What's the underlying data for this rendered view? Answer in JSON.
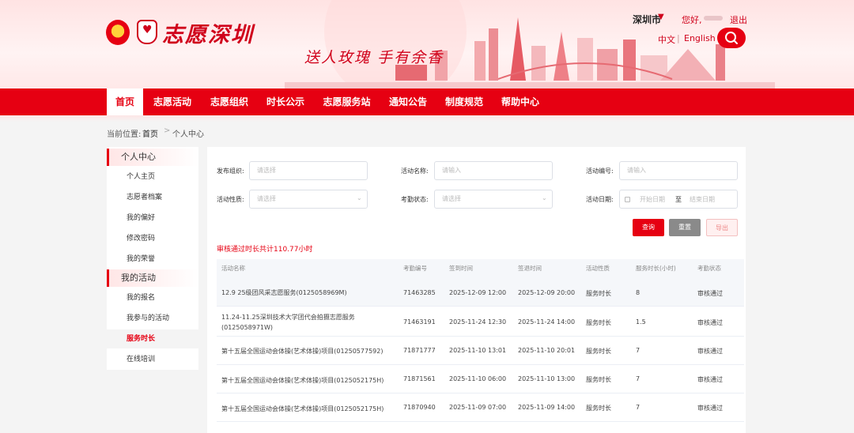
{
  "header": {
    "logo_text": "志愿深圳",
    "slogan": "送人玫瑰 手有余香",
    "city": "深圳市",
    "greeting": "您好,",
    "logout": "退出",
    "lang_zh": "中文",
    "lang_sep": "|",
    "lang_en": "English"
  },
  "nav": {
    "items": [
      "首页",
      "志愿活动",
      "志愿组织",
      "时长公示",
      "志愿服务站",
      "通知公告",
      "制度规范",
      "帮助中心"
    ]
  },
  "breadcrumb": {
    "prefix": "当前位置:",
    "home": "首页",
    "separator": ">",
    "current": "个人中心"
  },
  "sidebar": {
    "group1": "个人中心",
    "group1_items": [
      "个人主页",
      "志愿者档案",
      "我的偏好",
      "修改密码",
      "我的荣誉"
    ],
    "group2": "我的活动",
    "group2_items": [
      "我的报名",
      "我参与的活动",
      "服务时长",
      "在线培训"
    ]
  },
  "filters": {
    "org_label": "发布组织:",
    "org_placeholder": "请选择",
    "name_label": "活动名称:",
    "name_placeholder": "请输入",
    "code_label": "活动编号:",
    "code_placeholder": "请输入",
    "nature_label": "活动性质:",
    "nature_placeholder": "请选择",
    "attendance_label": "考勤状态:",
    "attendance_placeholder": "请选择",
    "date_label": "活动日期:",
    "date_start": "开始日期",
    "date_sep": "至",
    "date_end": "结束日期"
  },
  "buttons": {
    "query": "查询",
    "reset": "重置",
    "export": "导出"
  },
  "summary": "审核通过时长共计110.77小时",
  "table": {
    "columns": [
      "活动名称",
      "考勤编号",
      "签到时间",
      "签退时间",
      "活动性质",
      "服务时长(小时)",
      "考勤状态"
    ],
    "rows": [
      {
        "name": "12.9 25级团风采志愿服务(0125058969M)",
        "code": "71463285",
        "checkin": "2025-12-09 12:00",
        "checkout": "2025-12-09 20:00",
        "nature": "服务时长",
        "hours": "8",
        "status": "审核通过"
      },
      {
        "name": "11.24-11.25深圳技术大学团代会拍摄志愿服务(0125058971W)",
        "code": "71463191",
        "checkin": "2025-11-24 12:30",
        "checkout": "2025-11-24 14:00",
        "nature": "服务时长",
        "hours": "1.5",
        "status": "审核通过"
      },
      {
        "name": "第十五届全国运动会体操(艺术体操)项目(01250577592)",
        "code": "71871777",
        "checkin": "2025-11-10 13:01",
        "checkout": "2025-11-10 20:01",
        "nature": "服务时长",
        "hours": "7",
        "status": "审核通过"
      },
      {
        "name": "第十五届全国运动会体操(艺术体操)项目(0125052175H)",
        "code": "71871561",
        "checkin": "2025-11-10 06:00",
        "checkout": "2025-11-10 13:00",
        "nature": "服务时长",
        "hours": "7",
        "status": "审核通过"
      },
      {
        "name": "第十五届全国运动会体操(艺术体操)项目(0125052175H)",
        "code": "71870940",
        "checkin": "2025-11-09 07:00",
        "checkout": "2025-11-09 14:00",
        "nature": "服务时长",
        "hours": "7",
        "status": "审核通过"
      }
    ]
  }
}
